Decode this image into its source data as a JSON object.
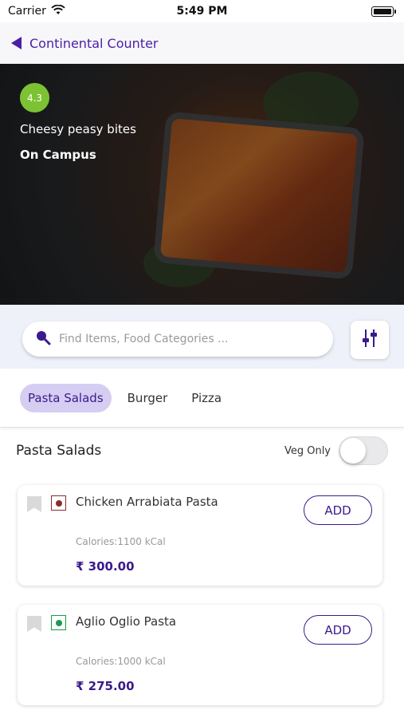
{
  "status_bar": {
    "carrier": "Carrier",
    "time": "5:49 PM",
    "wifi_icon": "wifi-icon",
    "battery_icon": "battery-icon"
  },
  "nav": {
    "back_icon": "back-triangle-icon",
    "title": "Continental Counter"
  },
  "hero": {
    "rating": "4.3",
    "tagline": "Cheesy peasy bites",
    "location": "On Campus"
  },
  "search": {
    "placeholder": "Find Items, Food Categories ...",
    "value": "",
    "icon": "search-icon",
    "filter_icon": "filter-sliders-icon"
  },
  "tabs": [
    {
      "label": "Pasta Salads",
      "active": true
    },
    {
      "label": "Burger",
      "active": false
    },
    {
      "label": "Pizza",
      "active": false
    }
  ],
  "section": {
    "title": "Pasta Salads",
    "veg_only_label": "Veg Only",
    "veg_only_on": false
  },
  "items": [
    {
      "name": "Chicken Arrabiata Pasta",
      "diet": "non-veg",
      "calories": "Calories:1100 kCal",
      "price": "₹ 300.00",
      "add_label": "ADD"
    },
    {
      "name": "Aglio Oglio Pasta",
      "diet": "veg",
      "calories": "Calories:1000 kCal",
      "price": "₹ 275.00",
      "add_label": "ADD"
    }
  ],
  "colors": {
    "brand": "#4b1ea8",
    "accent_dark": "#3b1a8c",
    "active_tab_bg": "#d6cdf3",
    "rating_green": "#7cc233",
    "veg_green": "#1e9a4c",
    "nonveg_red": "#8b2c2c"
  }
}
